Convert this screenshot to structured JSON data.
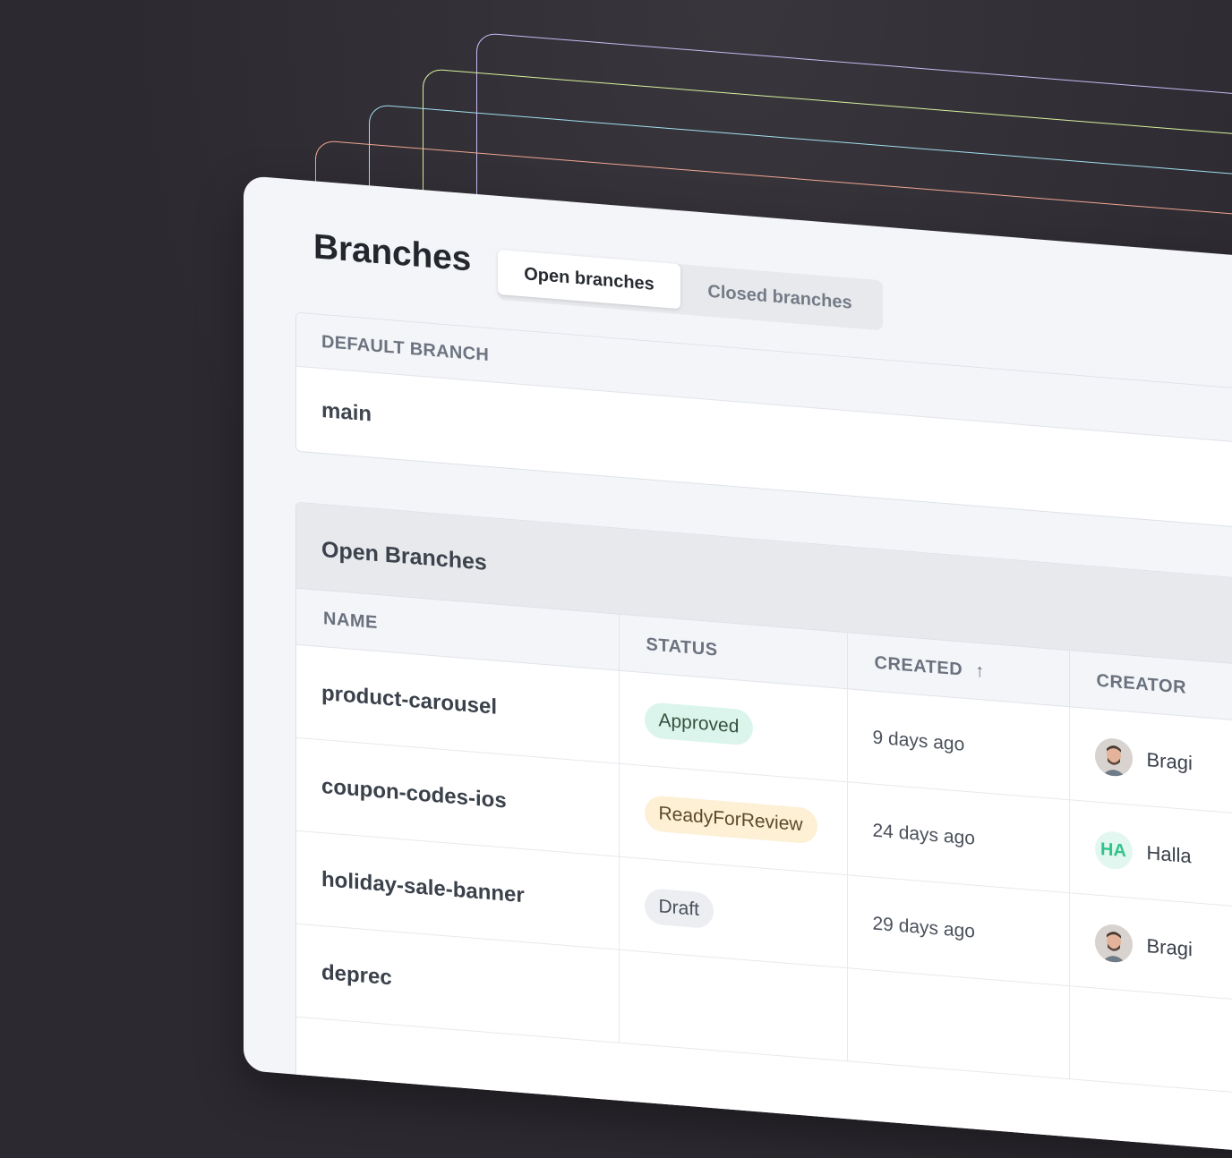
{
  "page": {
    "title": "Branches"
  },
  "tabs": [
    {
      "label": "Open branches",
      "active": true
    },
    {
      "label": "Closed branches",
      "active": false
    }
  ],
  "default_branch": {
    "header": "DEFAULT BRANCH",
    "value": "main"
  },
  "open_branches": {
    "title": "Open Branches",
    "columns": {
      "name": "NAME",
      "status": "STATUS",
      "created": "CREATED",
      "creator": "CREATOR"
    },
    "sort_icon": "arrow-up-icon",
    "rows": [
      {
        "name": "product-carousel",
        "status": "Approved",
        "created": "9 days ago",
        "creator": "Bragi",
        "avatar": "photo"
      },
      {
        "name": "coupon-codes-ios",
        "status": "ReadyForReview",
        "created": "24 days ago",
        "creator": "Halla",
        "avatar": "HA"
      },
      {
        "name": "holiday-sale-banner",
        "status": "Draft",
        "created": "29 days ago",
        "creator": "Bragi",
        "avatar": "photo"
      },
      {
        "name": "deprec",
        "status": "",
        "created": "",
        "creator": "",
        "avatar": ""
      }
    ]
  },
  "colors": {
    "background": "#2c2930",
    "ghost_frames": [
      "#f0a48f",
      "#9fdff0",
      "#d6f29a",
      "#c7b8f5"
    ],
    "approved_badge": "#dcf5ec",
    "review_badge": "#fdf0d4",
    "draft_badge": "#eceef2",
    "initials_avatar": "#30c48c"
  }
}
